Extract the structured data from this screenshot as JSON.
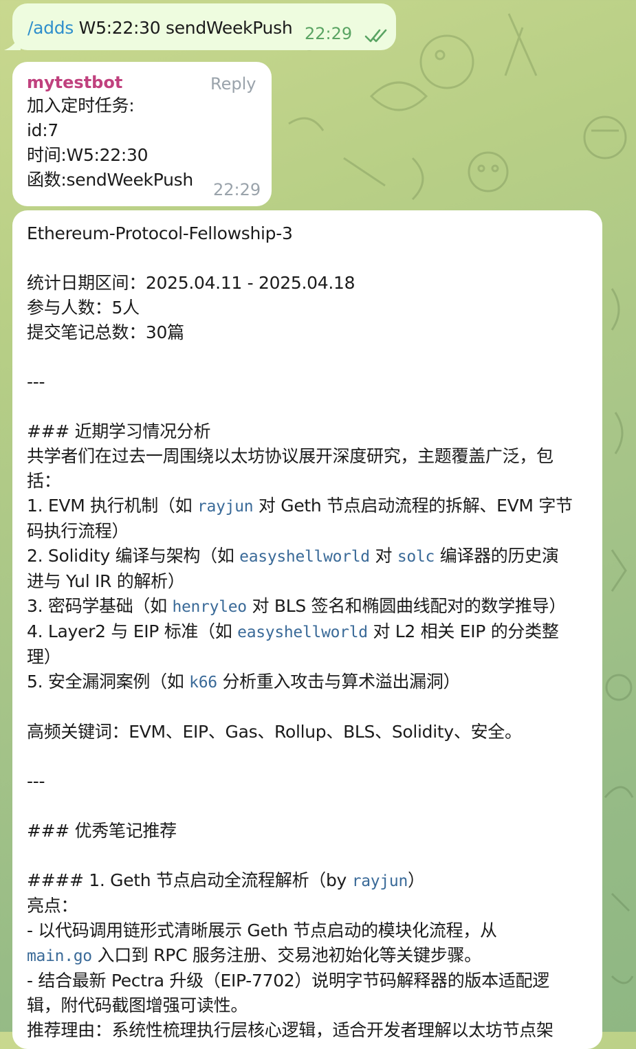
{
  "outgoing": {
    "command": "/adds",
    "args": " W5:22:30 sendWeekPush",
    "time": "22:29",
    "status_icon": "double-check-icon"
  },
  "bot_reply": {
    "sender": "mytestbot",
    "reply_label": "Reply",
    "lines": [
      "加入定时任务:",
      "id:7",
      "时间:W5:22:30",
      "函数:sendWeekPush"
    ],
    "time": "22:29"
  },
  "report": {
    "title": "Ethereum-Protocol-Fellowship-3",
    "date_range": "统计日期区间：2025.04.11 - 2025.04.18",
    "participants": "参与人数：5人",
    "notes_total": "提交笔记总数：30篇",
    "separator": "---",
    "section1_heading": "### 近期学习情况分析",
    "intro_l1": "共学者们在过去一周围绕以太坊协议展开深度研究，主题覆盖广泛，包",
    "intro_l2": "括：",
    "item1_a": "1. EVM 执行机制（如 ",
    "item1_m": "rayjun",
    "item1_b": " 对 Geth 节点启动流程的拆解、EVM 字节",
    "item1_c": "码执行流程）",
    "item2_a": "2. Solidity 编译与架构（如 ",
    "item2_m1": "easyshellworld",
    "item2_b": " 对 ",
    "item2_m2": "solc",
    "item2_c": " 编译器的历史演",
    "item2_d": "进与 Yul IR 的解析）",
    "item3_a": "3. 密码学基础（如 ",
    "item3_m": "henryleo",
    "item3_b": " 对 BLS 签名和椭圆曲线配对的数学推导）",
    "item4_a": "4. Layer2 与 EIP 标准（如 ",
    "item4_m": "easyshellworld",
    "item4_b": " 对 L2 相关 EIP 的分类整",
    "item4_c": "理）",
    "item5_a": "5. 安全漏洞案例（如 ",
    "item5_m": "k66",
    "item5_b": " 分析重入攻击与算术溢出漏洞）",
    "keywords": "高频关键词：EVM、EIP、Gas、Rollup、BLS、Solidity、安全。",
    "separator2": "---",
    "section2_heading": "### 优秀笔记推荐",
    "note1_heading_a": "#### 1. Geth 节点启动全流程解析（by ",
    "note1_heading_m": "rayjun",
    "note1_heading_b": "）",
    "highlights_label": "亮点：",
    "bullet1_a": "- 以代码调用链形式清晰展示 Geth 节点启动的模块化流程，从",
    "bullet1_m": "main.go",
    "bullet1_b": " 入口到 RPC 服务注册、交易池初始化等关键步骤。",
    "bullet2_a": "- 结合最新 Pectra 升级（EIP-7702）说明字节码解释器的版本适配逻",
    "bullet2_b": "辑，附代码截图增强可读性。",
    "reason": "推荐理由：系统性梳理执行层核心逻辑，适合开发者理解以太坊节点架"
  }
}
